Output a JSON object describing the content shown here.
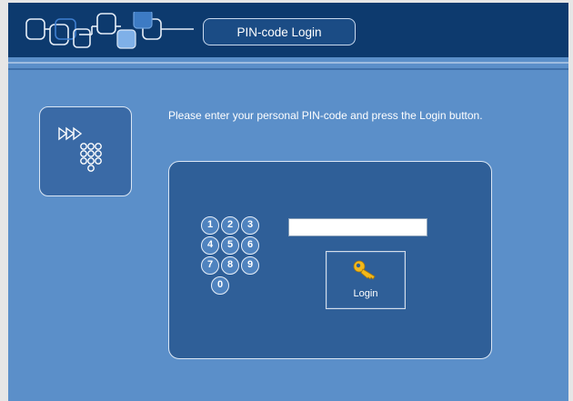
{
  "header": {
    "title": "PIN-code Login",
    "logo_icon": "connected-squares-logo"
  },
  "side_icon": "forward-arrows-keypad-icon",
  "instruction": "Please enter your personal PIN-code and press the Login button.",
  "keypad": {
    "keys": [
      "1",
      "2",
      "3",
      "4",
      "5",
      "6",
      "7",
      "8",
      "9",
      "0"
    ]
  },
  "pin_input": {
    "value": "",
    "placeholder": ""
  },
  "login_button": {
    "label": "Login",
    "icon": "key-icon"
  },
  "colors": {
    "header_bg": "#0d3a6e",
    "content_bg": "#5b8fc9",
    "panel_bg": "#2f5f98",
    "key_icon": "#f2b81b"
  }
}
